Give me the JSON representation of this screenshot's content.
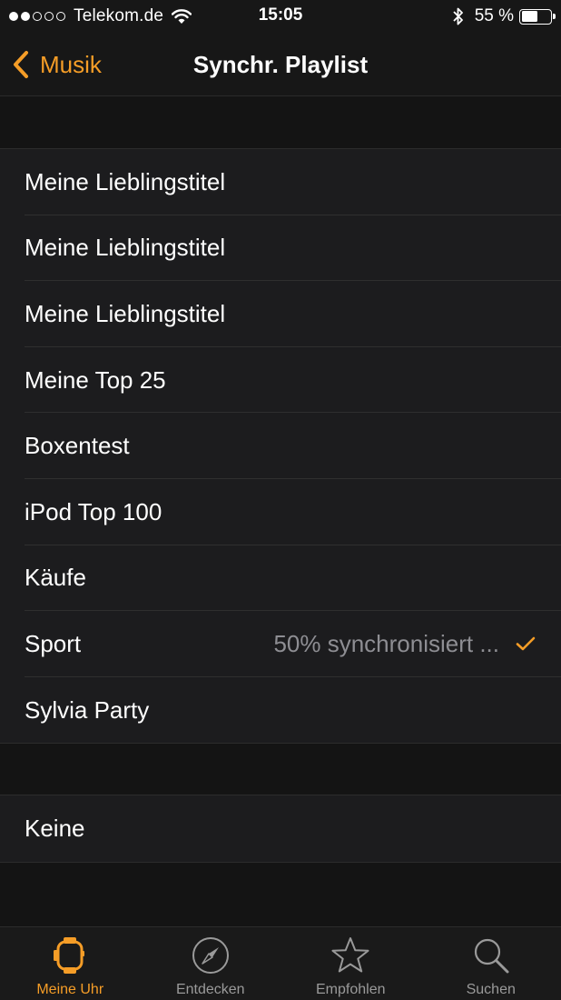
{
  "status_bar": {
    "carrier": "Telekom.de",
    "time": "15:05",
    "battery_percent": "55 %",
    "battery_level": 0.55,
    "signal_bars_filled": 2,
    "signal_bars_total": 5
  },
  "nav": {
    "back_label": "Musik",
    "title": "Synchr. Playlist"
  },
  "playlists": [
    {
      "label": "Meine Lieblingstitel"
    },
    {
      "label": "Meine Lieblingstitel"
    },
    {
      "label": "Meine Lieblingstitel"
    },
    {
      "label": "Meine Top 25"
    },
    {
      "label": "Boxentest"
    },
    {
      "label": "iPod Top 100"
    },
    {
      "label": "Käufe"
    },
    {
      "label": "Sport",
      "detail": "50% synchronisiert ...",
      "selected": true
    },
    {
      "label": "Sylvia Party"
    }
  ],
  "none_option": {
    "label": "Keine"
  },
  "tabs": [
    {
      "label": "Meine Uhr",
      "icon": "watch-icon",
      "active": true
    },
    {
      "label": "Entdecken",
      "icon": "compass-icon",
      "active": false
    },
    {
      "label": "Empfohlen",
      "icon": "star-icon",
      "active": false
    },
    {
      "label": "Suchen",
      "icon": "search-icon",
      "active": false
    }
  ],
  "colors": {
    "accent": "#f59d27",
    "background": "#141414",
    "cell": "#1c1c1e",
    "secondary_text": "#8e8e93"
  }
}
